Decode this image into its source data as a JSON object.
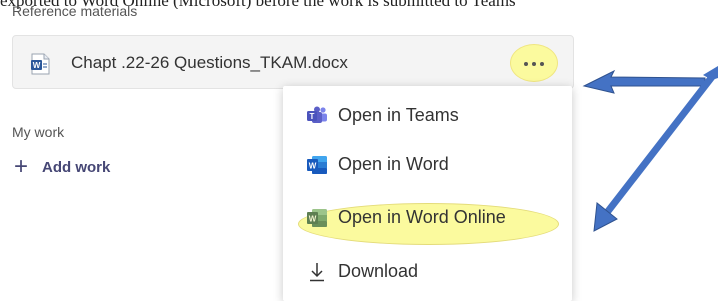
{
  "caption": "exported to Word Online (Microsoft) before the work is submitted to Teams",
  "reference": {
    "heading": "Reference materials",
    "file": {
      "name": "Chapt .22-26 Questions_TKAM.docx",
      "icon": "word-file-icon"
    },
    "more_icon": "more-options-icon"
  },
  "my_work": {
    "heading": "My work",
    "add_label": "Add work",
    "add_icon": "plus-icon"
  },
  "menu": {
    "items": [
      {
        "label": "Open in Teams",
        "icon": "teams-icon"
      },
      {
        "label": "Open in Word",
        "icon": "word-icon"
      },
      {
        "label": "Open in Word Online",
        "icon": "word-online-icon"
      },
      {
        "label": "Download",
        "icon": "download-icon"
      }
    ]
  },
  "colors": {
    "highlight": "#fbfa9e",
    "arrow": "#4472c4",
    "teams": "#5b5fc7",
    "word": "#2b579a",
    "word_online": "#6a8f5a",
    "add_work": "#464775"
  }
}
